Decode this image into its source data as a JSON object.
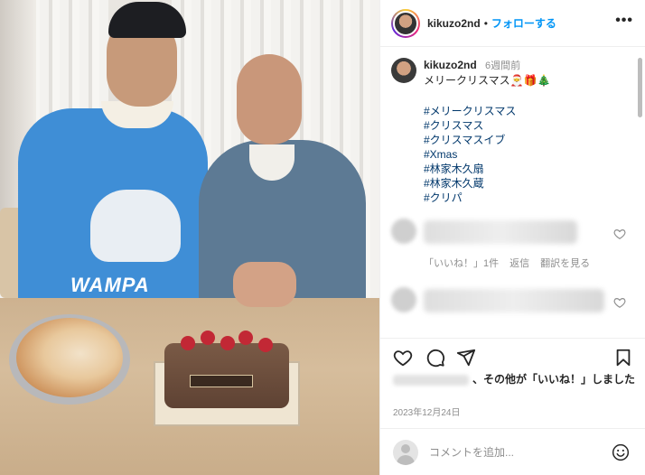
{
  "header": {
    "username": "kikuzo2nd",
    "separator": "•",
    "follow_label": "フォローする",
    "more_label": "•••"
  },
  "caption": {
    "username": "kikuzo2nd",
    "time": "6週間前",
    "text": "メリークリスマス🎅🎁🎄",
    "hashtags": [
      "#メリークリスマス",
      "#クリスマス",
      "#クリスマスイブ",
      "#Xmas",
      "#林家木久扇",
      "#林家木久蔵",
      "#クリパ"
    ]
  },
  "comment_meta": {
    "likes": "「いいね！」1件",
    "reply": "返信",
    "translate": "翻訳を見る"
  },
  "photo": {
    "shirt_text": "WAMPA"
  },
  "likes": {
    "text": "、その他が「いいね！」しました"
  },
  "date": "2023年12月24日",
  "comment_input": {
    "placeholder": "コメントを追加..."
  },
  "icons": [
    "heart-icon",
    "comment-icon",
    "share-icon",
    "bookmark-icon",
    "smiley-icon",
    "more-icon"
  ],
  "colors": {
    "link": "#00376b",
    "follow": "#0095f6",
    "muted": "#8e8e8e"
  }
}
